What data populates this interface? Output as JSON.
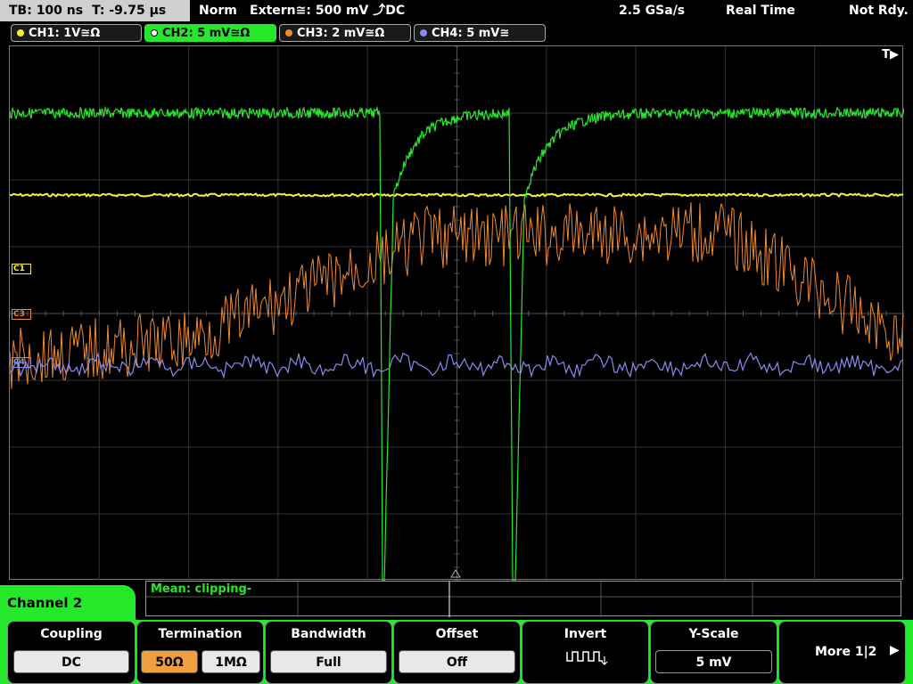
{
  "topbar": {
    "timebase": "TB: 100 ns",
    "trigger_time": "T: -9.75 µs",
    "mode": "Norm",
    "trigger_source": "Extern≅: 500 mV ⤴DC",
    "sample_rate": "2.5 GSa/s",
    "acq_mode": "Real Time",
    "status": "Not Rdy."
  },
  "channels": [
    {
      "label": "CH1: 1V≅Ω",
      "color": "#f5f03a"
    },
    {
      "label": "CH2: 5 mV≅Ω",
      "color": "#26e82b"
    },
    {
      "label": "CH3: 2 mV≅Ω",
      "color": "#f08a30"
    },
    {
      "label": "CH4: 5 mV≅",
      "color": "#8a8af0"
    }
  ],
  "markers": {
    "c1": "C1",
    "c3": "C3",
    "c4": "C4",
    "trigger": "T▶"
  },
  "measurement": {
    "text": "Mean: clipping-"
  },
  "menu": {
    "title": "Channel 2",
    "coupling": {
      "title": "Coupling",
      "value": "DC"
    },
    "termination": {
      "title": "Termination",
      "opt1": "50Ω",
      "opt2": "1MΩ"
    },
    "bandwidth": {
      "title": "Bandwidth",
      "value": "Full"
    },
    "offset": {
      "title": "Offset",
      "value": "Off"
    },
    "invert": {
      "title": "Invert",
      "icon": "inverted-square-wave-icon"
    },
    "yscale": {
      "title": "Y-Scale",
      "value": "5 mV"
    },
    "more": {
      "label": "More 1|2"
    }
  }
}
